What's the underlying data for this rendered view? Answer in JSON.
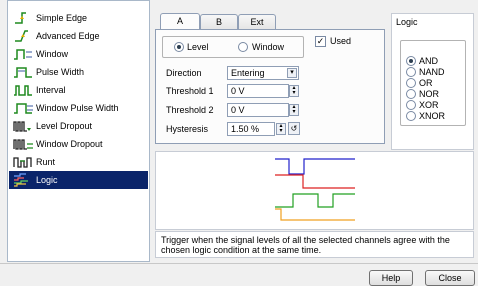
{
  "trigger_types": [
    {
      "label": "Simple Edge",
      "icon": "simple-edge-icon"
    },
    {
      "label": "Advanced Edge",
      "icon": "advanced-edge-icon"
    },
    {
      "label": "Window",
      "icon": "window-icon"
    },
    {
      "label": "Pulse Width",
      "icon": "pulse-width-icon"
    },
    {
      "label": "Interval",
      "icon": "interval-icon"
    },
    {
      "label": "Window Pulse Width",
      "icon": "window-pulse-width-icon"
    },
    {
      "label": "Level Dropout",
      "icon": "level-dropout-icon"
    },
    {
      "label": "Window Dropout",
      "icon": "window-dropout-icon"
    },
    {
      "label": "Runt",
      "icon": "runt-icon"
    },
    {
      "label": "Logic",
      "icon": "logic-icon",
      "selected": true
    }
  ],
  "tabs": [
    "A",
    "B",
    "Ext"
  ],
  "channel": {
    "level_label": "Level",
    "window_label": "Window",
    "used_label": "Used",
    "direction_label": "Direction",
    "direction_value": "Entering",
    "threshold1_label": "Threshold 1",
    "threshold1_value": "0 V",
    "threshold2_label": "Threshold 2",
    "threshold2_value": "0 V",
    "hysteresis_label": "Hysteresis",
    "hysteresis_value": "1.50 %"
  },
  "logic": {
    "title": "Logic",
    "options": [
      "AND",
      "NAND",
      "OR",
      "NOR",
      "XOR",
      "XNOR"
    ],
    "selected": "AND"
  },
  "description": "Trigger when the signal levels of all the selected channels agree with the chosen logic condition at the same time.",
  "buttons": {
    "help": "Help",
    "close": "Close"
  },
  "colors": {
    "selection": "#0a246a",
    "wave_a": "#2222cc",
    "wave_b": "#dd2222",
    "wave_c": "#22a022",
    "wave_d": "#f0a020"
  }
}
